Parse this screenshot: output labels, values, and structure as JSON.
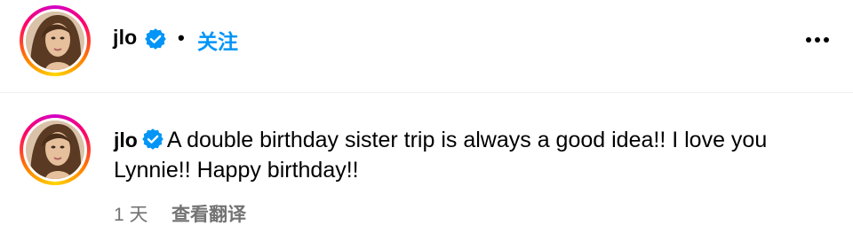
{
  "header": {
    "username": "jlo",
    "separator": "•",
    "follow_label": "关注"
  },
  "comment": {
    "username": "jlo",
    "text": "A double birthday sister trip is always a good idea!! I love you Lynnie!! Happy birthday!!",
    "time": "1 天",
    "translate_label": "查看翻译"
  },
  "icons": {
    "verified": "verified-badge-icon",
    "more": "more-options-icon"
  },
  "colors": {
    "accent": "#0095f6",
    "verified": "#0095f6",
    "muted_text": "#737373"
  }
}
